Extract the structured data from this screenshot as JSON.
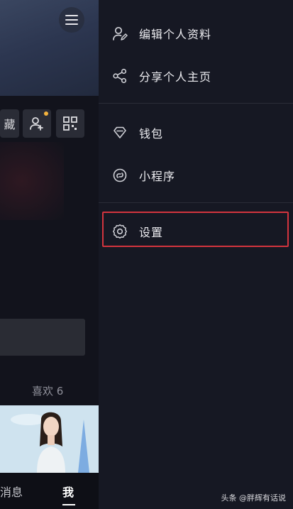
{
  "drawer": {
    "items": [
      {
        "label": "编辑个人资料",
        "icon": "edit-profile-icon"
      },
      {
        "label": "分享个人主页",
        "icon": "share-icon"
      },
      {
        "label": "钱包",
        "icon": "wallet-diamond-icon"
      },
      {
        "label": "小程序",
        "icon": "mini-program-icon"
      },
      {
        "label": "设置",
        "icon": "gear-icon"
      }
    ],
    "highlight_color": "#d3343e"
  },
  "profile": {
    "favorites_chip": "藏",
    "likes_label": "喜欢 6"
  },
  "bottom_nav": {
    "messages": "消息",
    "me": "我"
  },
  "watermark": "头条 @胖辉有话说"
}
